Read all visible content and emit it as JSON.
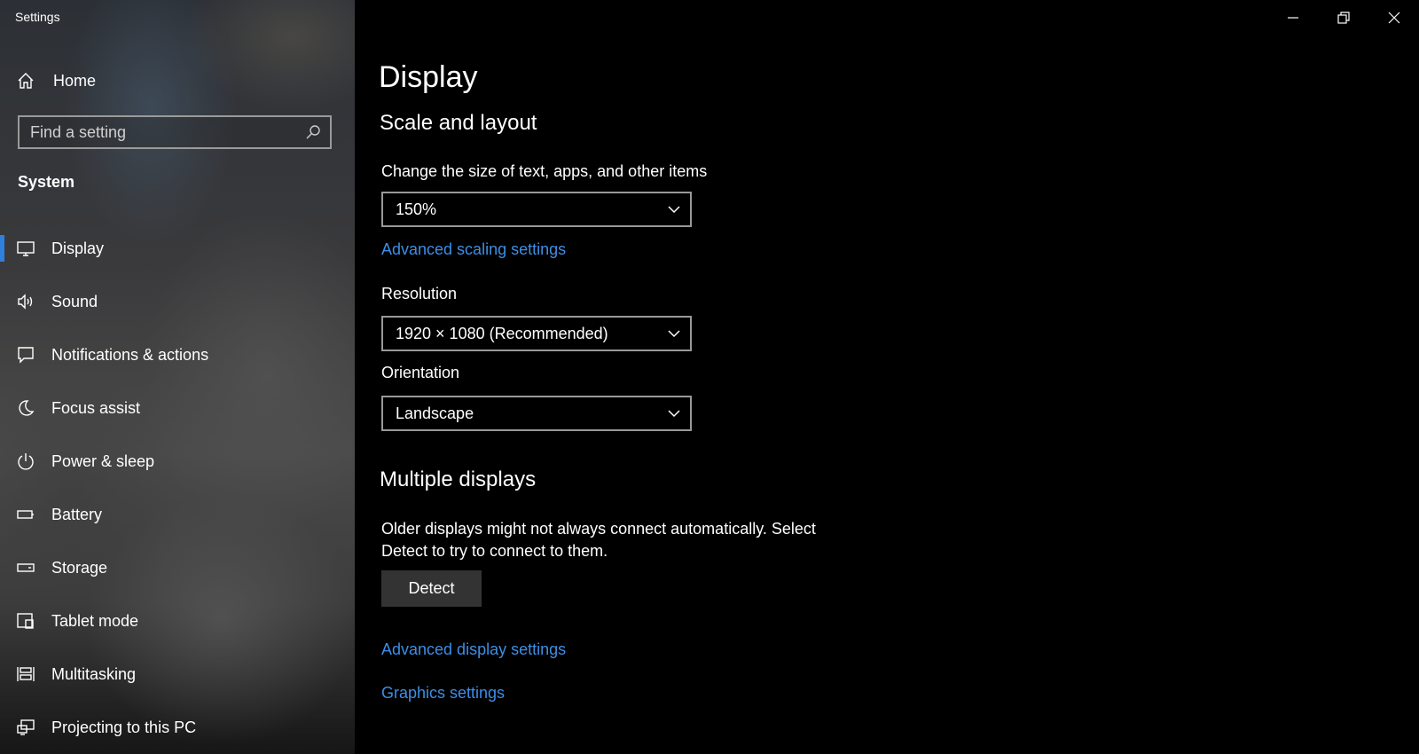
{
  "window": {
    "title": "Settings"
  },
  "sidebar": {
    "home_label": "Home",
    "search_placeholder": "Find a setting",
    "section": "System",
    "items": [
      {
        "label": "Display",
        "icon": "monitor-icon",
        "selected": true
      },
      {
        "label": "Sound",
        "icon": "speaker-icon"
      },
      {
        "label": "Notifications & actions",
        "icon": "notification-icon"
      },
      {
        "label": "Focus assist",
        "icon": "moon-icon"
      },
      {
        "label": "Power & sleep",
        "icon": "power-icon"
      },
      {
        "label": "Battery",
        "icon": "battery-icon"
      },
      {
        "label": "Storage",
        "icon": "storage-icon"
      },
      {
        "label": "Tablet mode",
        "icon": "tablet-mode-icon"
      },
      {
        "label": "Multitasking",
        "icon": "multitasking-icon"
      },
      {
        "label": "Projecting to this PC",
        "icon": "projecting-icon"
      }
    ]
  },
  "main": {
    "page_title": "Display",
    "scale_heading": "Scale and layout",
    "scale_label": "Change the size of text, apps, and other items",
    "scale_value": "150%",
    "advanced_scaling_link": "Advanced scaling settings",
    "resolution_label": "Resolution",
    "resolution_value": "1920 × 1080 (Recommended)",
    "orientation_label": "Orientation",
    "orientation_value": "Landscape",
    "multi_heading": "Multiple displays",
    "multi_desc": "Older displays might not always connect automatically. Select Detect to try to connect to them.",
    "detect_button": "Detect",
    "advanced_display_link": "Advanced display settings",
    "graphics_link": "Graphics settings"
  },
  "colors": {
    "accent": "#2f7fe0",
    "link": "#3d8ee6",
    "background": "#000000"
  }
}
